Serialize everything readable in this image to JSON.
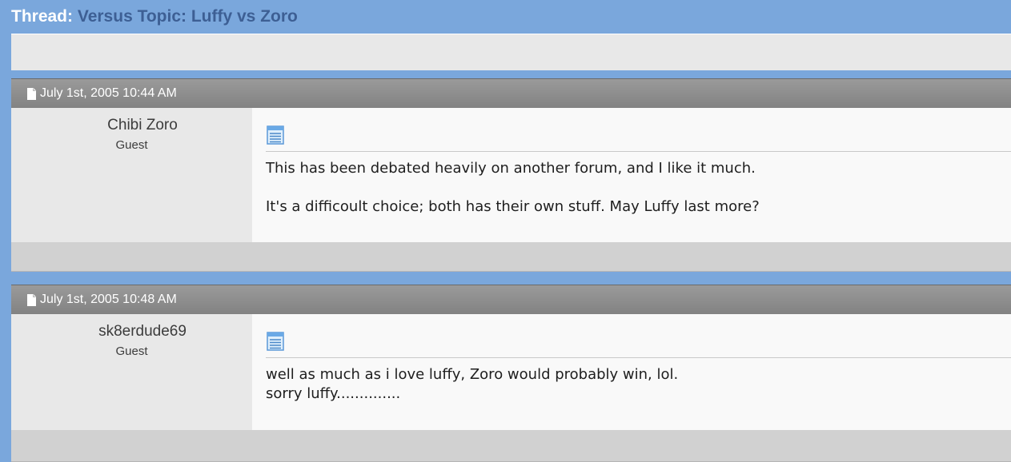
{
  "thread": {
    "label": "Thread:",
    "title": "Versus Topic: Luffy vs Zoro"
  },
  "posts": [
    {
      "date": "July 1st, 2005 10:44 AM",
      "username": "Chibi Zoro",
      "usertitle": "Guest",
      "paragraphs": [
        "This has been debated heavily on another forum, and I like it much.",
        "It's a difficoult choice; both has their own stuff. May Luffy last more?"
      ]
    },
    {
      "date": "July 1st, 2005 10:48 AM",
      "username": "sk8erdude69",
      "usertitle": "Guest",
      "lines": [
        "well as much as i love luffy, Zoro would probably win, lol.",
        "sorry luffy.............."
      ]
    }
  ],
  "colors": {
    "page_background": "#7aa7dc",
    "thread_link": "#3d5f94",
    "post_header": "#8e8e8e",
    "user_column": "#e8e8e8",
    "message_column": "#f9f9f9"
  },
  "icons": {
    "post_header_icon": "document-icon",
    "post_message_icon": "text-document-icon"
  }
}
